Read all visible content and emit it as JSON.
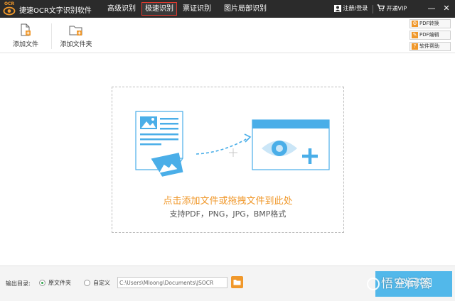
{
  "app": {
    "logo_text": "OCR",
    "title": "捷速OCR文字识别软件"
  },
  "nav": {
    "tabs": [
      {
        "label": "高级识别",
        "active": false
      },
      {
        "label": "极速识别",
        "active": true
      },
      {
        "label": "票证识别",
        "active": false
      },
      {
        "label": "图片局部识别",
        "active": false
      }
    ],
    "active_color": "#e03a2f"
  },
  "titlebar": {
    "login_label": "注册/登录",
    "vip_label": "开通VIP",
    "minimize_symbol": "—",
    "close_symbol": "✕"
  },
  "toolbar": {
    "add_file_label": "添加文件",
    "add_folder_label": "添加文件夹",
    "side_buttons": [
      {
        "label": "PDF转换",
        "icon": "gear-icon"
      },
      {
        "label": "PDF编辑",
        "icon": "pencil-icon"
      },
      {
        "label": "软件帮助",
        "icon": "question-icon"
      }
    ]
  },
  "dropzone": {
    "main_text": "点击添加文件或拖拽文件到此处",
    "sub_text": "支持PDF，PNG，JPG，BMP格式",
    "accent_color": "#f0982b",
    "illustration_color": "#4aaee8"
  },
  "bottom": {
    "output_label": "输出目录:",
    "option_original": "原文件夹",
    "option_custom": "自定义",
    "selected_option": "原文件夹",
    "path_value": "C:\\Users\\Mloong\\Documents\\JSOCR",
    "start_label": "开始识别",
    "start_color": "#52b8ea"
  },
  "watermark": {
    "text": "悟空问答"
  }
}
